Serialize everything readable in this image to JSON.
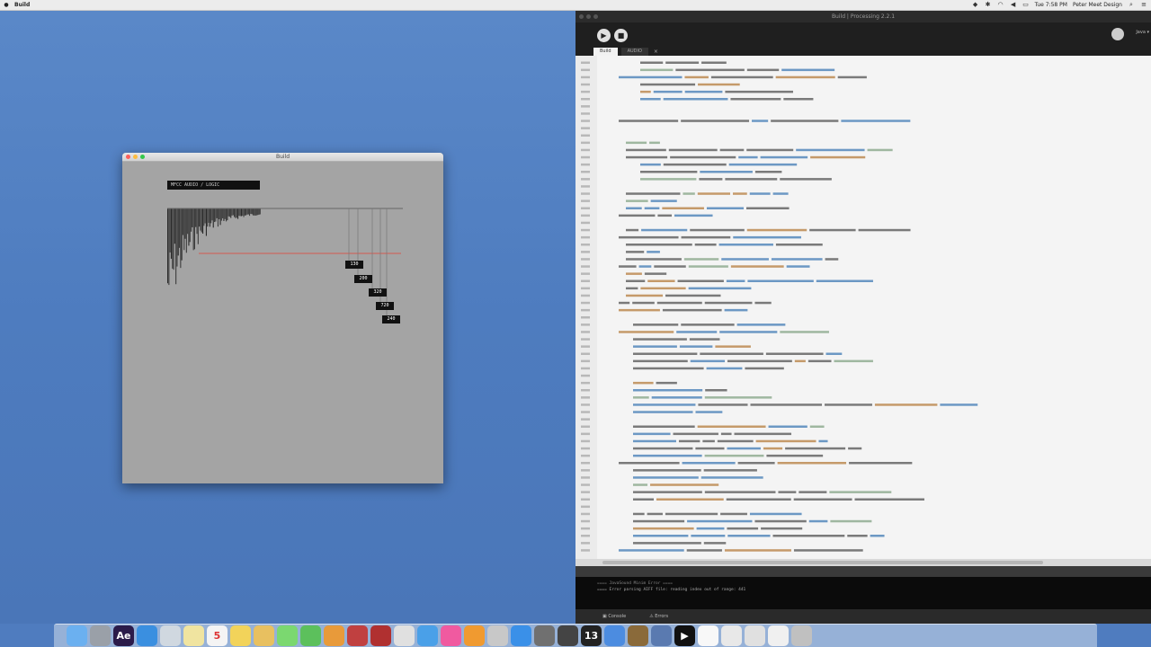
{
  "menubar": {
    "app_name": "Build",
    "clock": "Tue 7:58 PM",
    "user": "Peter Meet Design"
  },
  "sketch_window": {
    "title": "Build",
    "label_box": "MFCC AUDIO / LOGIC",
    "freq_tags": [
      "130",
      "200",
      "320",
      "720",
      "240"
    ]
  },
  "editor": {
    "window_title": "Build | Processing 2.2.1",
    "run_icon": "play-icon",
    "stop_icon": "stop-icon",
    "mode_label": "Java ▾",
    "tabs": [
      "Build",
      "AUDIO"
    ],
    "console_lines": [
      "==== JavaSound Minim Error ====",
      "==== Error parsing AIFF file: reading index out of range: 441"
    ],
    "bottom_tabs": [
      "Console",
      "Errors"
    ]
  },
  "dock": {
    "icons": [
      "finder-icon",
      "launchpad-icon",
      "after-effects-icon",
      "safari-icon",
      "preview-icon",
      "notes-icon",
      "calendar-icon",
      "stickies-icon",
      "photos-icon",
      "messages-icon",
      "facetime-icon",
      "books-icon",
      "photo-booth-icon",
      "puzzle-icon",
      "chrome-icon",
      "mail-icon",
      "itunes-icon",
      "ibooks-icon",
      "automator-icon",
      "app-store-icon",
      "system-preferences-icon",
      "calculator-icon",
      "13-icon",
      "chrome2-icon",
      "archive-icon",
      "network-icon",
      "play-icon",
      "document-icon",
      "folder-icon",
      "document2-icon",
      "document3-icon",
      "trash-icon"
    ]
  }
}
